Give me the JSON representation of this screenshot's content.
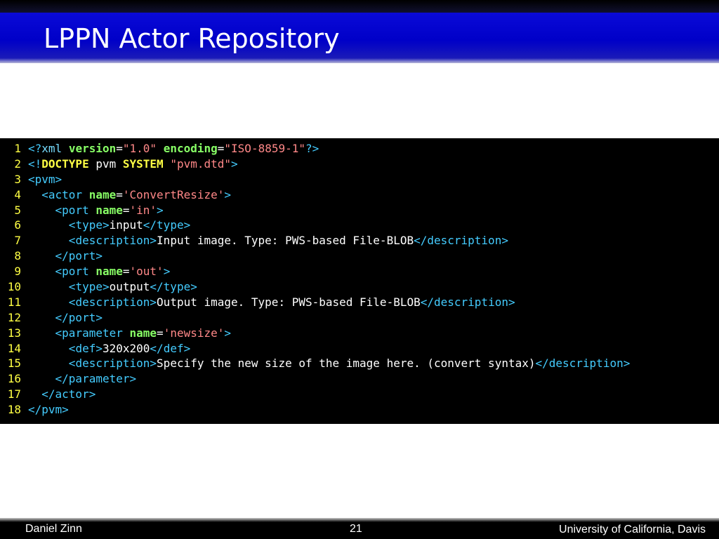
{
  "slide": {
    "title": "LPPN Actor Repository",
    "footer": {
      "author": "Daniel Zinn",
      "page_number": "21",
      "institution": "University of California, Davis"
    }
  },
  "code": {
    "lines": [
      {
        "n": "1",
        "tokens": [
          [
            "b",
            "<?"
          ],
          [
            "pi",
            "xml"
          ],
          [
            "tx",
            " "
          ],
          [
            "at",
            "version"
          ],
          [
            "eq",
            "="
          ],
          [
            "sv",
            "\"1.0\""
          ],
          [
            "tx",
            " "
          ],
          [
            "at",
            "encoding"
          ],
          [
            "eq",
            "="
          ],
          [
            "sv",
            "\"ISO-8859-1\""
          ],
          [
            "b",
            "?>"
          ]
        ]
      },
      {
        "n": "2",
        "tokens": [
          [
            "b",
            "<!"
          ],
          [
            "kw",
            "DOCTYPE"
          ],
          [
            "tx",
            " pvm "
          ],
          [
            "kw",
            "SYSTEM"
          ],
          [
            "tx",
            " "
          ],
          [
            "sv",
            "\"pvm.dtd\""
          ],
          [
            "b",
            ">"
          ]
        ]
      },
      {
        "n": "3",
        "tokens": [
          [
            "b",
            "<"
          ],
          [
            "t",
            "pvm"
          ],
          [
            "b",
            ">"
          ]
        ]
      },
      {
        "n": "4",
        "tokens": [
          [
            "tx",
            "  "
          ],
          [
            "b",
            "<"
          ],
          [
            "t",
            "actor"
          ],
          [
            "tx",
            " "
          ],
          [
            "at",
            "name"
          ],
          [
            "eq",
            "="
          ],
          [
            "sv",
            "'ConvertResize'"
          ],
          [
            "b",
            ">"
          ]
        ]
      },
      {
        "n": "5",
        "tokens": [
          [
            "tx",
            "    "
          ],
          [
            "b",
            "<"
          ],
          [
            "t",
            "port"
          ],
          [
            "tx",
            " "
          ],
          [
            "at",
            "name"
          ],
          [
            "eq",
            "="
          ],
          [
            "sv",
            "'in'"
          ],
          [
            "b",
            ">"
          ]
        ]
      },
      {
        "n": "6",
        "tokens": [
          [
            "tx",
            "      "
          ],
          [
            "b",
            "<"
          ],
          [
            "t",
            "type"
          ],
          [
            "b",
            ">"
          ],
          [
            "tx",
            "input"
          ],
          [
            "b",
            "</"
          ],
          [
            "t",
            "type"
          ],
          [
            "b",
            ">"
          ]
        ]
      },
      {
        "n": "7",
        "tokens": [
          [
            "tx",
            "      "
          ],
          [
            "b",
            "<"
          ],
          [
            "t",
            "description"
          ],
          [
            "b",
            ">"
          ],
          [
            "tx",
            "Input image. Type: PWS-based File-BLOB"
          ],
          [
            "b",
            "</"
          ],
          [
            "t",
            "description"
          ],
          [
            "b",
            ">"
          ]
        ]
      },
      {
        "n": "8",
        "tokens": [
          [
            "tx",
            "    "
          ],
          [
            "b",
            "</"
          ],
          [
            "t",
            "port"
          ],
          [
            "b",
            ">"
          ]
        ]
      },
      {
        "n": "9",
        "tokens": [
          [
            "tx",
            "    "
          ],
          [
            "b",
            "<"
          ],
          [
            "t",
            "port"
          ],
          [
            "tx",
            " "
          ],
          [
            "at",
            "name"
          ],
          [
            "eq",
            "="
          ],
          [
            "sv",
            "'out'"
          ],
          [
            "b",
            ">"
          ]
        ]
      },
      {
        "n": "10",
        "tokens": [
          [
            "tx",
            "      "
          ],
          [
            "b",
            "<"
          ],
          [
            "t",
            "type"
          ],
          [
            "b",
            ">"
          ],
          [
            "tx",
            "output"
          ],
          [
            "b",
            "</"
          ],
          [
            "t",
            "type"
          ],
          [
            "b",
            ">"
          ]
        ]
      },
      {
        "n": "11",
        "tokens": [
          [
            "tx",
            "      "
          ],
          [
            "b",
            "<"
          ],
          [
            "t",
            "description"
          ],
          [
            "b",
            ">"
          ],
          [
            "tx",
            "Output image. Type: PWS-based File-BLOB"
          ],
          [
            "b",
            "</"
          ],
          [
            "t",
            "description"
          ],
          [
            "b",
            ">"
          ]
        ]
      },
      {
        "n": "12",
        "tokens": [
          [
            "tx",
            "    "
          ],
          [
            "b",
            "</"
          ],
          [
            "t",
            "port"
          ],
          [
            "b",
            ">"
          ]
        ]
      },
      {
        "n": "13",
        "tokens": [
          [
            "tx",
            "    "
          ],
          [
            "b",
            "<"
          ],
          [
            "t",
            "parameter"
          ],
          [
            "tx",
            " "
          ],
          [
            "at",
            "name"
          ],
          [
            "eq",
            "="
          ],
          [
            "sv",
            "'newsize'"
          ],
          [
            "b",
            ">"
          ]
        ]
      },
      {
        "n": "14",
        "tokens": [
          [
            "tx",
            "      "
          ],
          [
            "b",
            "<"
          ],
          [
            "t",
            "def"
          ],
          [
            "b",
            ">"
          ],
          [
            "tx",
            "320x200"
          ],
          [
            "b",
            "</"
          ],
          [
            "t",
            "def"
          ],
          [
            "b",
            ">"
          ]
        ]
      },
      {
        "n": "15",
        "tokens": [
          [
            "tx",
            "      "
          ],
          [
            "b",
            "<"
          ],
          [
            "t",
            "description"
          ],
          [
            "b",
            ">"
          ],
          [
            "tx",
            "Specify the new size of the image here. (convert syntax)"
          ],
          [
            "b",
            "</"
          ],
          [
            "t",
            "description"
          ],
          [
            "b",
            ">"
          ]
        ]
      },
      {
        "n": "16",
        "tokens": [
          [
            "tx",
            "    "
          ],
          [
            "b",
            "</"
          ],
          [
            "t",
            "parameter"
          ],
          [
            "b",
            ">"
          ]
        ]
      },
      {
        "n": "17",
        "tokens": [
          [
            "tx",
            "  "
          ],
          [
            "b",
            "</"
          ],
          [
            "t",
            "actor"
          ],
          [
            "b",
            ">"
          ]
        ]
      },
      {
        "n": "18",
        "tokens": [
          [
            "b",
            "</"
          ],
          [
            "t",
            "pvm"
          ],
          [
            "b",
            ">"
          ]
        ]
      }
    ]
  },
  "colors": {
    "title_band": "#0000c8",
    "line_numbers": "#ffff44",
    "tags": "#44ccff",
    "attributes": "#88ff66",
    "strings": "#ff8888",
    "keywords": "#ffff44",
    "text": "#ffffff"
  }
}
